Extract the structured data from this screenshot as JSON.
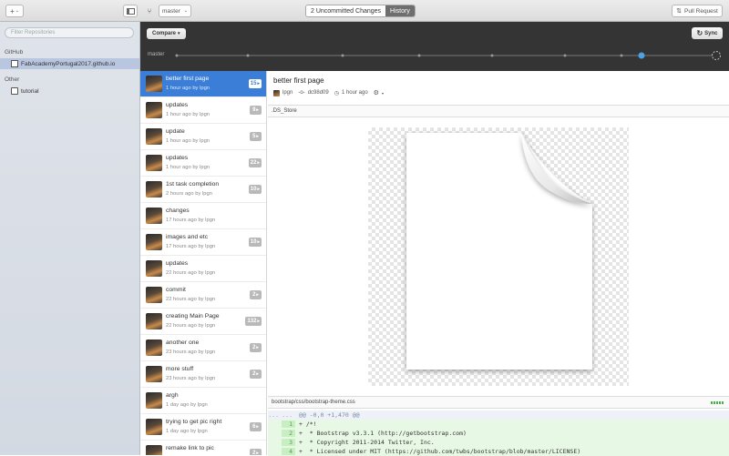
{
  "toolbar": {
    "add_label": "+",
    "branch": "master",
    "tab_changes": "2 Uncommitted Changes",
    "tab_history": "History",
    "pull_request": "Pull Request"
  },
  "sidebar": {
    "filter_placeholder": "Filter Repositories",
    "github_section": "GitHub",
    "github_repo": "FabAcademyPortugal2017.github.io",
    "other_section": "Other",
    "other_repo": "tutorial"
  },
  "timeline": {
    "compare_label": "Compare",
    "sync_label": "Sync",
    "branch_label": "master"
  },
  "commits": [
    {
      "title": "better first page",
      "meta": "1 hour ago by lpgn",
      "count": "15"
    },
    {
      "title": "updates",
      "meta": "1 hour ago by lpgn",
      "count": "9"
    },
    {
      "title": "update",
      "meta": "1 hour ago by lpgn",
      "count": "5"
    },
    {
      "title": "updates",
      "meta": "1 hour ago by lpgn",
      "count": "22"
    },
    {
      "title": "1st task completion",
      "meta": "2 hours ago by lpgn",
      "count": "10"
    },
    {
      "title": "changes",
      "meta": "17 hours ago by lpgn",
      "count": ""
    },
    {
      "title": "images and etc",
      "meta": "17 hours ago by lpgn",
      "count": "10"
    },
    {
      "title": "updates",
      "meta": "22 hours ago by lpgn",
      "count": ""
    },
    {
      "title": "commit",
      "meta": "22 hours ago by lpgn",
      "count": "2"
    },
    {
      "title": "creating Main Page",
      "meta": "22 hours ago by lpgn",
      "count": "132"
    },
    {
      "title": "another one",
      "meta": "23 hours ago by lpgn",
      "count": "2"
    },
    {
      "title": "more stuff",
      "meta": "23 hours ago by lpgn",
      "count": "2"
    },
    {
      "title": "argh",
      "meta": "1 day ago by lpgn",
      "count": ""
    },
    {
      "title": "trying to get pic right",
      "meta": "1 day ago by lpgn",
      "count": "6"
    },
    {
      "title": "remake link to pic",
      "meta": "1 day ago by lpgn",
      "count": "2"
    }
  ],
  "detail": {
    "title": "better first page",
    "author": "lpgn",
    "sha": "dc98d09",
    "time": "1 hour ago",
    "file1": ".DS_Store",
    "file2": "bootstrap/css/bootstrap-theme.css",
    "diff_ellipsis_1": "...",
    "diff_ellipsis_2": "...",
    "hunk": "@@ -0,0 +1,470 @@",
    "lines": [
      {
        "n": "1",
        "text": "+ /*!"
      },
      {
        "n": "2",
        "text": "+  * Bootstrap v3.3.1 (http://getbootstrap.com)"
      },
      {
        "n": "3",
        "text": "+  * Copyright 2011-2014 Twitter, Inc."
      },
      {
        "n": "4",
        "text": "+  * Licensed under MIT (https://github.com/twbs/bootstrap/blob/master/LICENSE)"
      }
    ]
  }
}
